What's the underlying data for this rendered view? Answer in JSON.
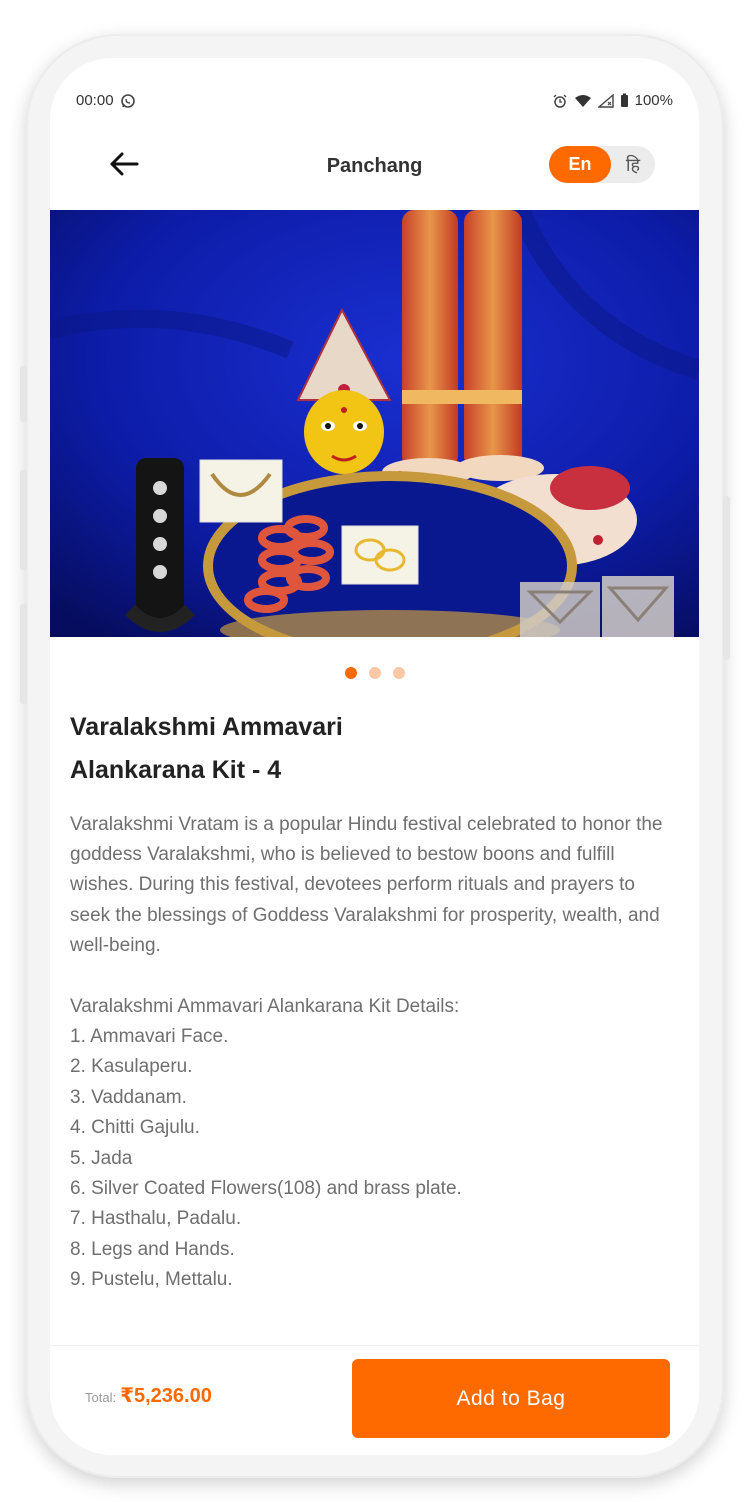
{
  "status_bar": {
    "time": "00:00",
    "battery": "100%",
    "left_icons": [
      "whatsapp-icon"
    ],
    "right_icons": [
      "alarm-icon",
      "wifi-icon",
      "signal-icon",
      "battery-icon"
    ]
  },
  "header": {
    "title": "Panchang",
    "back_icon": "arrow-left-icon",
    "lang_en": "En",
    "lang_hi": "हि"
  },
  "carousel": {
    "image": "Varalakshmi Ammavari Alankarana kit items on a blue cloth",
    "slide_count": 3,
    "active_index": 0
  },
  "product": {
    "title_line1": "Varalakshmi Ammavari",
    "title_line2": "Alankarana Kit - 4",
    "description": "Varalakshmi Vratam is a popular Hindu festival celebrated to honor the goddess Varalakshmi, who is believed to bestow boons and fulfill wishes. During this festival, devotees perform rituals and prayers to seek the blessings of Goddess Varalakshmi for prosperity, wealth, and well-being.",
    "details_heading": "Varalakshmi Ammavari Alankarana Kit Details:",
    "details": [
      "1. Ammavari Face.",
      "2. Kasulaperu.",
      "3. Vaddanam.",
      "4. Chitti Gajulu.",
      "5. Jada",
      "6. Silver Coated Flowers(108) and brass plate.",
      "7. Hasthalu, Padalu.",
      "8. Legs and Hands.",
      "9. Pustelu, Mettalu."
    ]
  },
  "bottom_bar": {
    "total_label": "Total:",
    "total_value": "₹5,236.00",
    "add_button": "Add to Bag"
  },
  "colors": {
    "accent": "#ff6a00",
    "image_background": "#0b1a9e"
  }
}
